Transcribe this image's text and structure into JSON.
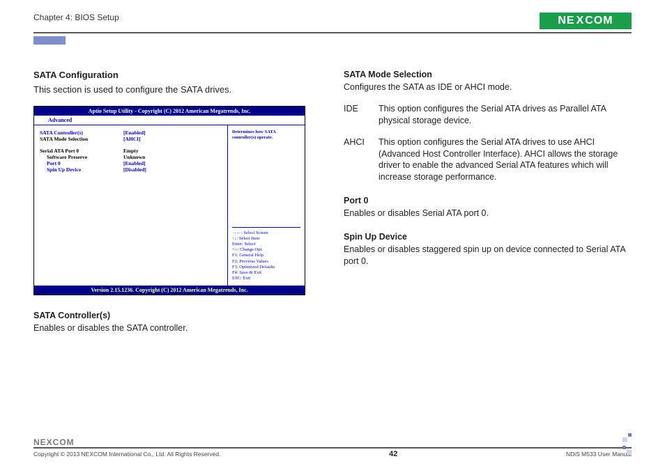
{
  "header": {
    "chapter": "Chapter 4: BIOS Setup",
    "logo_prefix": "NE",
    "logo_x": "X",
    "logo_suffix": "COM"
  },
  "left": {
    "title": "SATA Configuration",
    "intro": "This section is used to configure the SATA drives.",
    "sub1_head": "SATA Controller(s)",
    "sub1_text": "Enables or disables the SATA controller."
  },
  "bios": {
    "topbar": "Aptio Setup Utility - Copyright (C) 2012 American Megatrends, Inc.",
    "tab": "Advanced",
    "rows": [
      {
        "k": "SATA Controller(s)",
        "v": "[Enabled]",
        "kClass": "blue",
        "vClass": "blue"
      },
      {
        "k": "SATA Mode Selection",
        "v": "[AHCI]",
        "kClass": "white",
        "vClass": "blue"
      }
    ],
    "rows2": [
      {
        "k": "Serial ATA Port 0",
        "v": "Empty",
        "kClass": "white",
        "vClass": "white"
      },
      {
        "k": "Software Preserve",
        "v": "Unknown",
        "kClass": "white indent",
        "vClass": "white"
      },
      {
        "k": "Port 0",
        "v": "[Enabled]",
        "kClass": "blue indent",
        "vClass": "blue"
      },
      {
        "k": "Spin Up Device",
        "v": "[Disabled]",
        "kClass": "blue indent",
        "vClass": "blue"
      }
    ],
    "help": "Determines how SATA controller(s) operate.",
    "keys": [
      "→←: Select Screen",
      "↑↓: Select Item",
      "Enter: Select",
      "+/-: Change Opt.",
      "F1: General Help",
      "F2: Previous Values",
      "F3: Optimized Defaults",
      "F4: Save & Exit",
      "ESC: Exit"
    ],
    "bottombar": "Version 2.15.1236. Copyright (C) 2012 American Megatrends, Inc."
  },
  "right": {
    "h1": "SATA Mode Selection",
    "h1_text": "Configures the SATA as IDE or AHCI mode.",
    "ide_term": "IDE",
    "ide_desc": "This option configures the Serial ATA drives as Parallel ATA physical storage device.",
    "ahci_term": "AHCI",
    "ahci_desc": "This option configures the Serial ATA drives to use AHCI (Advanced Host Controller Interface). AHCI allows the storage driver to enable the advanced Serial ATA features which will increase storage performance.",
    "h2": "Port 0",
    "h2_text": "Enables or disables Serial ATA port 0.",
    "h3": "Spin Up Device",
    "h3_text": "Enables or disables staggered spin up on device connected to Serial ATA port 0."
  },
  "footer": {
    "logo": "NEXCOM",
    "copy": "Copyright © 2013 NEXCOM International Co., Ltd. All Rights Reserved.",
    "page": "42",
    "doc": "NDiS M533 User Manual"
  }
}
